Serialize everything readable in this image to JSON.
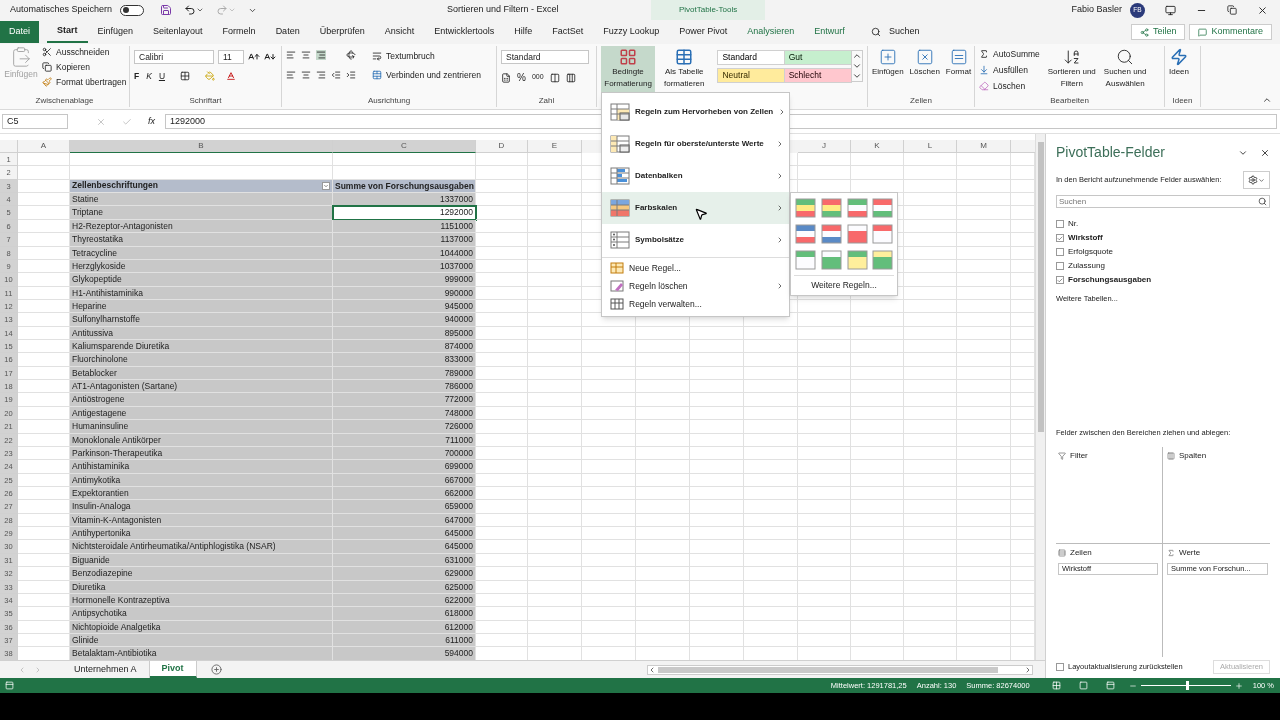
{
  "titlebar": {
    "autosave_label": "Automatisches Speichern",
    "autosave_on": false,
    "title": "Sortieren und Filtern  -  Excel",
    "context_tab": "PivotTable-Tools",
    "user": "Fabio Basler",
    "initials": "FB"
  },
  "tabs": [
    {
      "label": "Datei",
      "kind": "file",
      "selected": false
    },
    {
      "label": "Start",
      "kind": "normal",
      "selected": true
    },
    {
      "label": "Einfügen",
      "kind": "normal",
      "selected": false
    },
    {
      "label": "Seitenlayout",
      "kind": "normal",
      "selected": false
    },
    {
      "label": "Formeln",
      "kind": "normal",
      "selected": false
    },
    {
      "label": "Daten",
      "kind": "normal",
      "selected": false
    },
    {
      "label": "Überprüfen",
      "kind": "normal",
      "selected": false
    },
    {
      "label": "Ansicht",
      "kind": "normal",
      "selected": false
    },
    {
      "label": "Entwicklertools",
      "kind": "normal",
      "selected": false
    },
    {
      "label": "Hilfe",
      "kind": "normal",
      "selected": false
    },
    {
      "label": "FactSet",
      "kind": "normal",
      "selected": false
    },
    {
      "label": "Fuzzy Lookup",
      "kind": "normal",
      "selected": false
    },
    {
      "label": "Power Pivot",
      "kind": "normal",
      "selected": false
    },
    {
      "label": "Analysieren",
      "kind": "context",
      "selected": false
    },
    {
      "label": "Entwurf",
      "kind": "context",
      "selected": false
    }
  ],
  "tell_me": "Suchen",
  "share": "Teilen",
  "comments": "Kommentare",
  "ribbon": {
    "clipboard": {
      "label": "Zwischenablage",
      "paste": "Einfügen",
      "paste_disabled": true,
      "cut": "Ausschneiden",
      "copy": "Kopieren",
      "painter": "Format übertragen"
    },
    "font": {
      "label": "Schriftart",
      "name": "Calibri",
      "size": "11",
      "bold": "F",
      "italic": "K",
      "underline": "U"
    },
    "alignment": {
      "label": "Ausrichtung",
      "wrap": "Textumbruch",
      "merge": "Verbinden und zentrieren"
    },
    "number": {
      "label": "Zahl",
      "format": "Standard",
      "percent": "%",
      "thousands": "000"
    },
    "styles": {
      "conditional": {
        "lines": [
          "Bedingte",
          "Formatierung"
        ],
        "selected": true
      },
      "table": {
        "lines": [
          "Als Tabelle",
          "formatieren"
        ]
      },
      "cell_styles": [
        {
          "label": "Standard",
          "color": "#ffffff"
        },
        {
          "label": "Gut",
          "color": "#c6efce"
        },
        {
          "label": "Neutral",
          "color": "#ffeb9c"
        },
        {
          "label": "Schlecht",
          "color": "#ffc7ce"
        }
      ]
    },
    "cells": {
      "label": "Zellen",
      "buttons": [
        "Einfügen",
        "Löschen",
        "Format"
      ]
    },
    "editing": {
      "label": "Bearbeiten",
      "autosum": "AutoSumme",
      "fill": "Ausfüllen",
      "clear": "Löschen",
      "sort": [
        "Sortieren und",
        "Filtern"
      ],
      "find": [
        "Suchen und",
        "Auswählen"
      ]
    },
    "ideas": {
      "label": "Ideen",
      "button": "Ideen"
    }
  },
  "formula_bar": {
    "cell": "C5",
    "function_symbol": "fx",
    "value": "1292000"
  },
  "sheet": {
    "columns_left": [
      "A",
      "B",
      "C",
      "D",
      "E"
    ],
    "columns_right": [
      "J",
      "K",
      "L",
      "M"
    ],
    "row_numbers": [
      "1",
      "2",
      "3",
      "4",
      "5",
      "6",
      "7",
      "8",
      "9",
      "10",
      "11",
      "12",
      "13",
      "14",
      "15",
      "16",
      "17",
      "18",
      "19",
      "20",
      "21",
      "22",
      "23",
      "24",
      "25",
      "26",
      "27",
      "28",
      "29",
      "30",
      "31",
      "32",
      "33",
      "34",
      "35",
      "36",
      "37",
      "38"
    ],
    "pivot_header": {
      "label": "Zellenbeschriftungen",
      "value": "Summe von Forschungsausgaben"
    },
    "rows": [
      {
        "label": "Statine",
        "value": "1337000",
        "selected": false
      },
      {
        "label": "Triptane",
        "value": "1292000",
        "selected": true
      },
      {
        "label": "H2-Rezeptor-Antagonisten",
        "value": "1151000",
        "selected": false
      },
      {
        "label": "Thyreostatika",
        "value": "1137000",
        "selected": false
      },
      {
        "label": "Tetracycline",
        "value": "1044000",
        "selected": false
      },
      {
        "label": "Herzglykoside",
        "value": "1037000",
        "selected": false
      },
      {
        "label": "Glykopeptide",
        "value": "999000",
        "selected": false
      },
      {
        "label": "H1-Antihistaminika",
        "value": "990000",
        "selected": false
      },
      {
        "label": "Heparine",
        "value": "945000",
        "selected": false
      },
      {
        "label": "Sulfonylharnstoffe",
        "value": "940000",
        "selected": false
      },
      {
        "label": "Antitussiva",
        "value": "895000",
        "selected": false
      },
      {
        "label": "Kaliumsparende Diuretika",
        "value": "874000",
        "selected": false
      },
      {
        "label": "Fluorchinolone",
        "value": "833000",
        "selected": false
      },
      {
        "label": "Betablocker",
        "value": "789000",
        "selected": false
      },
      {
        "label": "AT1-Antagonisten (Sartane)",
        "value": "786000",
        "selected": false
      },
      {
        "label": "Antiöstrogene",
        "value": "772000",
        "selected": false
      },
      {
        "label": "Antigestagene",
        "value": "748000",
        "selected": false
      },
      {
        "label": "Humaninsuline",
        "value": "726000",
        "selected": false
      },
      {
        "label": "Monoklonale Antikörper",
        "value": "711000",
        "selected": false
      },
      {
        "label": "Parkinson-Therapeutika",
        "value": "700000",
        "selected": false
      },
      {
        "label": "Antihistaminika",
        "value": "699000",
        "selected": false
      },
      {
        "label": "Antimykotika",
        "value": "667000",
        "selected": false
      },
      {
        "label": "Expektorantien",
        "value": "662000",
        "selected": false
      },
      {
        "label": "Insulin-Analoga",
        "value": "659000",
        "selected": false
      },
      {
        "label": "Vitamin-K-Antagonisten",
        "value": "647000",
        "selected": false
      },
      {
        "label": "Antihypertonika",
        "value": "645000",
        "selected": false
      },
      {
        "label": "Nichtsteroidale Antirheumatika/Antiphlogistika (NSAR)",
        "value": "645000",
        "selected": false
      },
      {
        "label": "Biguanide",
        "value": "631000",
        "selected": false
      },
      {
        "label": "Benzodiazepine",
        "value": "629000",
        "selected": false
      },
      {
        "label": "Diuretika",
        "value": "625000",
        "selected": false
      },
      {
        "label": "Hormonelle Kontrazeptiva",
        "value": "622000",
        "selected": false
      },
      {
        "label": "Antipsychotika",
        "value": "618000",
        "selected": false
      },
      {
        "label": "Nichtopioide Analgetika",
        "value": "612000",
        "selected": false
      },
      {
        "label": "Glinide",
        "value": "611000",
        "selected": false
      },
      {
        "label": "Betalaktam-Antibiotika",
        "value": "594000",
        "selected": false
      }
    ]
  },
  "menu": {
    "rules": [
      {
        "label": "Regeln zum Hervorheben von Zellen",
        "kind": "highlight",
        "submenu": true,
        "highlighted": false
      },
      {
        "label": "Regeln für oberste/unterste Werte",
        "kind": "topbottom",
        "submenu": true,
        "highlighted": false
      },
      {
        "label": "Datenbalken",
        "kind": "databar",
        "submenu": true,
        "highlighted": false
      },
      {
        "label": "Farbskalen",
        "kind": "colorscale",
        "submenu": true,
        "highlighted": true
      },
      {
        "label": "Symbolsätze",
        "kind": "iconset",
        "submenu": true,
        "highlighted": false
      }
    ],
    "actions": [
      {
        "label": "Neue Regel...",
        "kind": "new",
        "submenu": false,
        "highlighted": false
      },
      {
        "label": "Regeln löschen",
        "kind": "clear",
        "submenu": true,
        "highlighted": false
      },
      {
        "label": "Regeln verwalten...",
        "kind": "manage",
        "submenu": false,
        "highlighted": false
      }
    ],
    "submenu_more": "Weitere Regeln..."
  },
  "sheet_tabs": [
    {
      "label": "Unternehmen A",
      "selected": false
    },
    {
      "label": "Pivot",
      "selected": true
    }
  ],
  "pivot_pane": {
    "title": "PivotTable-Felder",
    "subtitle": "In den Bericht aufzunehmende Felder auswählen:",
    "search_placeholder": "Suchen",
    "fields": [
      {
        "label": "Nr.",
        "checked": false
      },
      {
        "label": "Wirkstoff",
        "checked": true
      },
      {
        "label": "Erfolgsquote",
        "checked": false
      },
      {
        "label": "Zulassung",
        "checked": false
      },
      {
        "label": "Forschungsausgaben",
        "checked": true
      }
    ],
    "more_tables": "Weitere Tabellen...",
    "drag_hint": "Felder zwischen den Bereichen ziehen und ablegen:",
    "areas": [
      {
        "label": "Filter",
        "kind": "filter"
      },
      {
        "label": "Spalten",
        "kind": "columns"
      },
      {
        "label": "Zeilen",
        "kind": "rows",
        "item": "Wirkstoff"
      },
      {
        "label": "Werte",
        "kind": "values",
        "item": "Summe von Forschun..."
      }
    ],
    "defer_label": "Layoutaktualisierung zurückstellen",
    "defer_checked": false,
    "update_button": "Aktualisieren",
    "update_disabled": true
  },
  "status_bar": {
    "average": "Mittelwert: 1291781,25",
    "count": "Anzahl: 130",
    "sum": "Summe: 82674000",
    "zoom": "100 %",
    "zoom_slider": {
      "level": 0.5
    }
  }
}
